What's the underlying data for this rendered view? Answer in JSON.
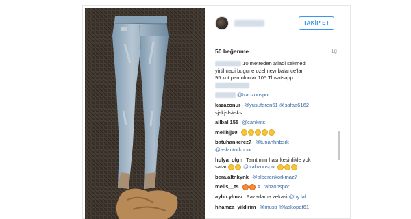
{
  "post": {
    "follow_label": "TAKİP ET",
    "likes": "50 beğenme",
    "age": "1g"
  },
  "caption": {
    "line1": "10 metreden atladi sekmedi",
    "line2": "yirtilmadi bugune ozel new balance'lar",
    "line3": "95 kot pantolonlar 105 Tl watsapp"
  },
  "comments": [
    {
      "user": "",
      "mention": "@trabzonspor",
      "text": ""
    },
    {
      "user": "kazazonur",
      "mention": "@yusuferen61 @safaa6162",
      "text": ""
    },
    {
      "user": "",
      "mention": "",
      "text": "sjskjslsksks"
    },
    {
      "user": "allball155",
      "mention": "@canknts!",
      "text": ""
    },
    {
      "user": "melihjj50",
      "mention": "",
      "text": ""
    },
    {
      "user": "batuhankerez7",
      "mention": "@tunahhnbsrk",
      "text": ""
    },
    {
      "user": "",
      "mention": "@aslanturkonur",
      "text": ""
    },
    {
      "user": "hulya_olgn",
      "mention": "",
      "text": "Tanıtımın hası kesinlikle yok"
    },
    {
      "user": "",
      "mention": "@trabzonspor",
      "text": "satar"
    },
    {
      "user": "bera.altnkynk",
      "mention": "@alperenkorkmaz7",
      "text": ""
    },
    {
      "user": "melis__ts",
      "mention": "#Trabzonspor",
      "text": ""
    },
    {
      "user": "ayhn.ylmzz",
      "mention": "@hy.lal",
      "text": "Pazarlama zekasi"
    },
    {
      "user": "hhamza_yildirim",
      "mention": "@musti @laskopat61",
      "text": ""
    }
  ],
  "icons": {
    "avatar": "profile-avatar",
    "emoji": "laughing-emoji"
  },
  "colors": {
    "accent": "#3897f0",
    "mention": "#3b6ba5",
    "emoji": "#f5c63b"
  }
}
